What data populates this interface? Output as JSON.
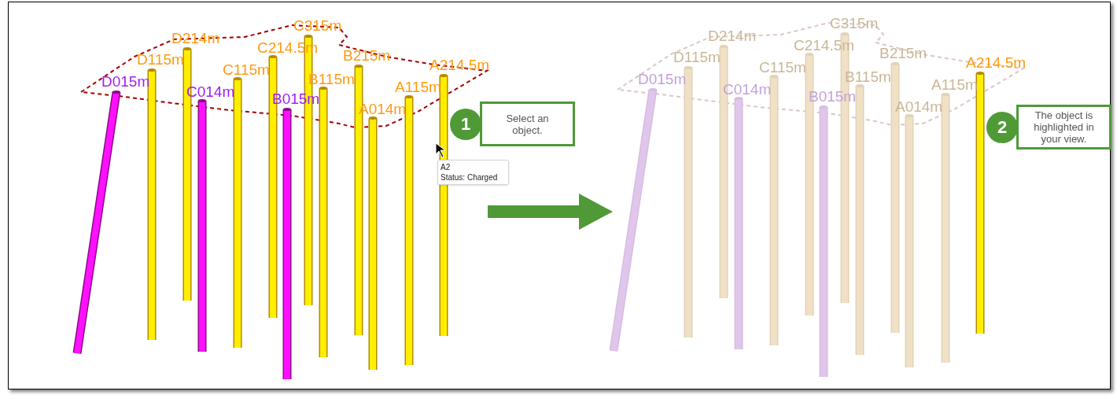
{
  "views": [
    {
      "holes": [
        {
          "label": "D015m",
          "kind": "uncharged",
          "faded": false
        },
        {
          "label": "D115m",
          "kind": "charged",
          "faded": false
        },
        {
          "label": "D214m",
          "kind": "charged",
          "faded": false
        },
        {
          "label": "C014m",
          "kind": "uncharged",
          "faded": false
        },
        {
          "label": "C115m",
          "kind": "charged",
          "faded": false
        },
        {
          "label": "C214.5m",
          "kind": "charged",
          "faded": false
        },
        {
          "label": "C315m",
          "kind": "charged",
          "faded": false
        },
        {
          "label": "B015m",
          "kind": "uncharged",
          "faded": false
        },
        {
          "label": "B115m",
          "kind": "charged",
          "faded": false
        },
        {
          "label": "B215m",
          "kind": "charged",
          "faded": false
        },
        {
          "label": "A014m",
          "kind": "charged",
          "faded": false
        },
        {
          "label": "A115m",
          "kind": "charged",
          "faded": false
        },
        {
          "label": "A214.5m",
          "kind": "charged",
          "faded": false
        }
      ],
      "boundary_faded": false,
      "tooltip": {
        "title": "A2",
        "status": "Status: Charged"
      },
      "callout": {
        "number": "1",
        "text": "Select an object."
      }
    },
    {
      "holes": [
        {
          "label": "D015m",
          "kind": "uncharged",
          "faded": true
        },
        {
          "label": "D115m",
          "kind": "charged",
          "faded": true
        },
        {
          "label": "D214m",
          "kind": "charged",
          "faded": true
        },
        {
          "label": "C014m",
          "kind": "uncharged",
          "faded": true
        },
        {
          "label": "C115m",
          "kind": "charged",
          "faded": true
        },
        {
          "label": "C214.5m",
          "kind": "charged",
          "faded": true
        },
        {
          "label": "C315m",
          "kind": "charged",
          "faded": true
        },
        {
          "label": "B015m",
          "kind": "uncharged",
          "faded": true
        },
        {
          "label": "B115m",
          "kind": "charged",
          "faded": true
        },
        {
          "label": "B215m",
          "kind": "charged",
          "faded": true
        },
        {
          "label": "A014m",
          "kind": "charged",
          "faded": true
        },
        {
          "label": "A115m",
          "kind": "charged",
          "faded": true
        },
        {
          "label": "A214.5m",
          "kind": "charged",
          "faded": false
        }
      ],
      "boundary_faded": true,
      "callout": {
        "number": "2",
        "text": "The object is highlighted in your view."
      }
    }
  ]
}
